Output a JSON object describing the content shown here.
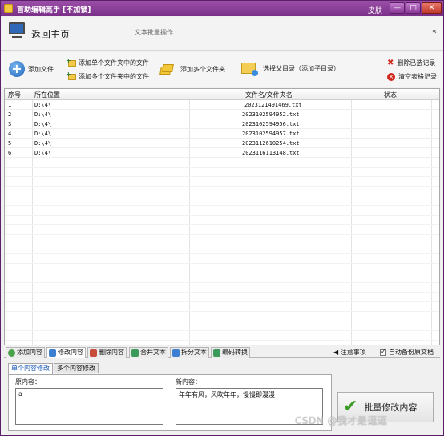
{
  "titlebar": {
    "title": "首助编辑高手 [不加锁]",
    "skin": "皮肤",
    "min": "—",
    "max": "□",
    "close": "✕"
  },
  "header": {
    "home": "返回主页",
    "subtitle": "文本批量操作",
    "collapse": "«"
  },
  "toolbar": {
    "add_file": "添加文件",
    "add_single_folder": "添加单个文件夹中的文件",
    "add_multi_folder": "添加多个文件夹中的文件",
    "add_folders": "添加多个文件夹",
    "select_parent": "选择父目录（添加子目录）",
    "delete_selected": "删除已选记录",
    "clear_table": "清空表格记录"
  },
  "table": {
    "columns": [
      "序号",
      "所在位置",
      "文件名/文件夹名",
      "状态"
    ],
    "rows": [
      {
        "n": "1",
        "path": "D:\\4\\",
        "name": "2023121491469.txt",
        "status": ""
      },
      {
        "n": "2",
        "path": "D:\\4\\",
        "name": "2023102594952.txt",
        "status": ""
      },
      {
        "n": "3",
        "path": "D:\\4\\",
        "name": "2023102594956.txt",
        "status": ""
      },
      {
        "n": "4",
        "path": "D:\\4\\",
        "name": "2023102594957.txt",
        "status": ""
      },
      {
        "n": "5",
        "path": "D:\\4\\",
        "name": "2023112610254.txt",
        "status": ""
      },
      {
        "n": "6",
        "path": "D:\\4\\",
        "name": "2023116113148.txt",
        "status": ""
      }
    ]
  },
  "tabs": {
    "items": [
      "添加内容",
      "修改内容",
      "删除内容",
      "合并文本",
      "拆分文本",
      "编码转换"
    ],
    "active": "修改内容",
    "notice": "注意事项",
    "backup": "自动备份原文档"
  },
  "panel": {
    "subtabs": [
      "单个内容修改",
      "多个内容修改"
    ],
    "original_label": "原内容：",
    "original_value": "a",
    "new_label": "新内容：",
    "new_value": "年年有风，风吹年年，慢慢即漫漫",
    "submit": "批量修改内容"
  },
  "watermark": "CSDN @我才是逗逗",
  "colors": {
    "titlebar": "#8a3a97",
    "accent": "#1e63b8",
    "danger": "#d0271b",
    "ok": "#3c9d26"
  }
}
